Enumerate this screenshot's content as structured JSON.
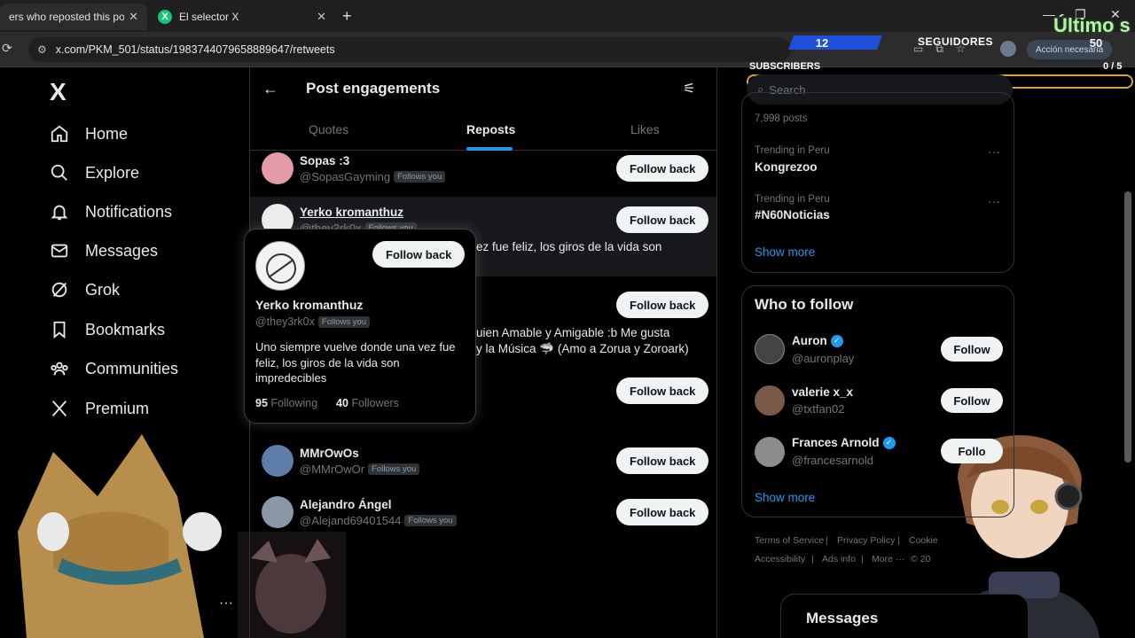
{
  "browser": {
    "tabs": [
      {
        "title": "ers who reposted this post /",
        "close": "✕"
      },
      {
        "title": "El selector X",
        "close": "✕",
        "favicon": "X"
      }
    ],
    "new_tab": "+",
    "url": "x.com/PKM_501/status/1983744079658889647/retweets",
    "accion": "Acción necesaria"
  },
  "overlay": {
    "ultimo": "Último s",
    "left_count": "12",
    "seguidores_label": "SEGUIDORES",
    "seguidores_value": "50",
    "subs_label": "SUBSCRIBERS",
    "subs_value": "0 / 5"
  },
  "nav": {
    "logo": "X",
    "items": [
      {
        "label": "Home",
        "icon": "home-icon"
      },
      {
        "label": "Explore",
        "icon": "search-icon"
      },
      {
        "label": "Notifications",
        "icon": "bell-icon"
      },
      {
        "label": "Messages",
        "icon": "mail-icon"
      },
      {
        "label": "Grok",
        "icon": "grok-icon"
      },
      {
        "label": "Bookmarks",
        "icon": "bookmark-icon"
      },
      {
        "label": "Communities",
        "icon": "communities-icon"
      },
      {
        "label": "Premium",
        "icon": "x-premium-icon"
      }
    ],
    "more": "···"
  },
  "main": {
    "title": "Post engagements",
    "tabs": [
      "Quotes",
      "Reposts",
      "Likes"
    ],
    "active_tab": "Reposts",
    "users": [
      {
        "name": "Sopas :3",
        "handle": "@SopasGayming",
        "badge": "Follows you",
        "button": "Follow back"
      },
      {
        "name": "Yerko kromanthuz",
        "handle": "@they3rk0x",
        "badge": "Follows you",
        "button": "Follow back",
        "bio_fragment": "ez fue feliz, los giros de la vida son"
      },
      {
        "name": "",
        "handle": "",
        "button": "Follow back",
        "bio_line1": "uien Amable y Amigable :b Me gusta",
        "bio_line2": "y la Música 🦈 (Amo a Zorua y Zoroark)"
      },
      {
        "name": "",
        "handle": "",
        "button": "Follow back"
      },
      {
        "name": "MMrOwOs",
        "handle": "@MMrOwOr",
        "badge": "Follows you",
        "button": "Follow back"
      },
      {
        "name": "Alejandro Ángel",
        "handle": "@Alejand69401544",
        "badge": "Follows you",
        "button": "Follow back"
      }
    ]
  },
  "hovercard": {
    "name": "Yerko kromanthuz",
    "handle": "@they3rk0x",
    "badge": "Follows you",
    "button": "Follow back",
    "bio": "Uno siempre vuelve donde una vez fue feliz, los giros de la vida son impredecibles",
    "following_count": "95",
    "following_label": "Following",
    "followers_count": "40",
    "followers_label": "Followers"
  },
  "right": {
    "search_placeholder": "Search",
    "posts_count": "7,998 posts",
    "trends": [
      {
        "context": "Trending in Peru",
        "name": "Kongrezoo"
      },
      {
        "context": "Trending in Peru",
        "name": "#N60Noticias"
      }
    ],
    "show_more": "Show more",
    "who_to_follow": "Who to follow",
    "suggestions": [
      {
        "name": "Auron",
        "handle": "@auronplay",
        "verified": true,
        "button": "Follow"
      },
      {
        "name": "valerie x_x",
        "handle": "@txtfan02",
        "verified": false,
        "button": "Follow"
      },
      {
        "name": "Frances Arnold",
        "handle": "@francesarnold",
        "verified": true,
        "button": "Follo"
      }
    ],
    "show_more_2": "Show more",
    "footer": [
      "Terms of Service",
      "Privacy Policy",
      "Cookie",
      "Accessibility",
      "Ads info",
      "More ···",
      "© 20"
    ],
    "messages": "Messages"
  },
  "colors": {
    "accent": "#1d9bf0",
    "bg": "#000000",
    "border": "#2f3336",
    "muted": "#71767b"
  }
}
